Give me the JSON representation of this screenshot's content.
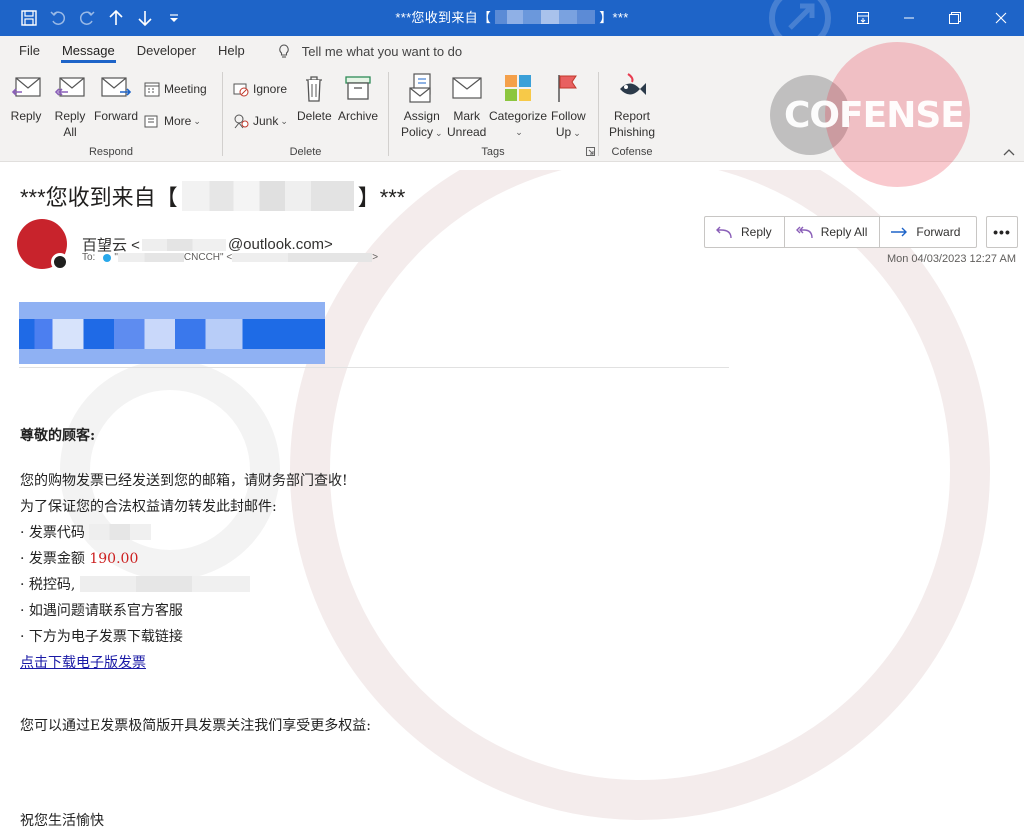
{
  "window": {
    "title_prefix": "***您收到来自【",
    "title_suffix": "】***"
  },
  "ribbon": {
    "tabs": [
      "File",
      "Message",
      "Developer",
      "Help"
    ],
    "tell_me": "Tell me what you want to do",
    "groups": {
      "respond": {
        "label": "Respond",
        "reply": "Reply",
        "reply_all_1": "Reply",
        "reply_all_2": "All",
        "forward": "Forward",
        "meeting": "Meeting",
        "more": "More"
      },
      "delete": {
        "label": "Delete",
        "ignore": "Ignore",
        "junk": "Junk",
        "delete": "Delete",
        "archive": "Archive"
      },
      "tags": {
        "label": "Tags",
        "assign_1": "Assign",
        "assign_2": "Policy",
        "mark_1": "Mark",
        "mark_2": "Unread",
        "categorize": "Categorize",
        "follow_1": "Follow",
        "follow_2": "Up"
      },
      "cofense": {
        "label": "Cofense",
        "report_1": "Report",
        "report_2": "Phishing"
      }
    }
  },
  "watermark": {
    "brand": "COFENSE"
  },
  "message": {
    "subject_prefix": "***您收到来自【",
    "subject_suffix": "】***",
    "sender_name": "百望云 <",
    "sender_domain": "@outlook.com>",
    "to_label": "To:",
    "to_mid": "CNCCH\" <",
    "to_end": ">",
    "to_quote": "\"",
    "date": "Mon 04/03/2023 12:27 AM",
    "actions": {
      "reply": "Reply",
      "reply_all": "Reply All",
      "forward": "Forward",
      "more": "•••"
    }
  },
  "body": {
    "greeting": "尊敬的顾客:",
    "line1": "您的购物发票已经发送到您的邮箱，请财务部门查收!",
    "line2": "为了保证您的合法权益请勿转发此封邮件:",
    "bullet_code": "· 发票代码",
    "bullet_amount_label": "· 发票金额",
    "bullet_amount_value": "190.00",
    "bullet_tax": "· 税控码,",
    "bullet_contact": "· 如遇问题请联系官方客服",
    "bullet_download": "· 下方为电子发票下载链接",
    "download_link": "点击下载电子版发票",
    "promo": "您可以通过E发票极简版开具发票关注我们享受更多权益:",
    "closing": "祝您生活愉快"
  },
  "colors": {
    "titlebar": "#1e64c8",
    "accent": "#1e64c8",
    "avatar": "#c8232c",
    "amount": "#cc1f1f",
    "link": "#1a1aa6",
    "cofense_red": "#e83c50"
  }
}
